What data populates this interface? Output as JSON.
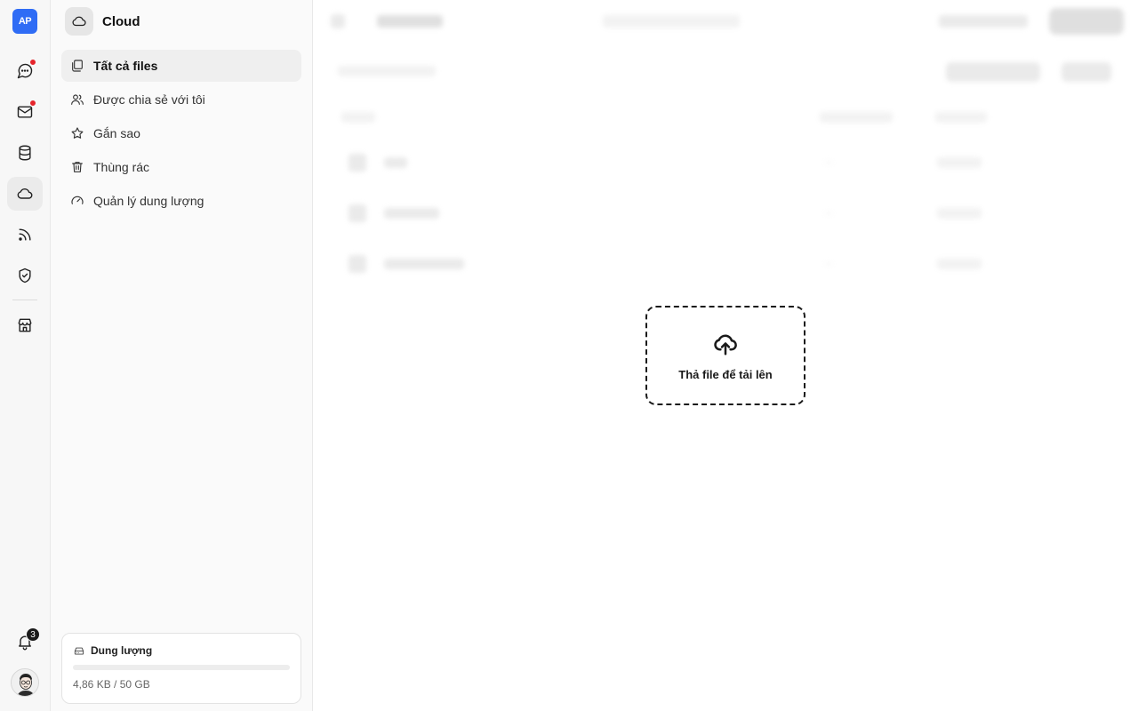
{
  "rail": {
    "logo_text": "AP",
    "items": [
      {
        "icon": "chat-icon",
        "has_dot": true
      },
      {
        "icon": "mail-icon",
        "has_dot": true
      },
      {
        "icon": "database-icon",
        "has_dot": false
      },
      {
        "icon": "cloud-icon",
        "has_dot": false,
        "active": true
      },
      {
        "icon": "rss-icon",
        "has_dot": false
      },
      {
        "icon": "shield-check-icon",
        "has_dot": false
      },
      {
        "icon": "store-icon",
        "has_dot": false
      }
    ],
    "notification_count": "3"
  },
  "sidebar": {
    "title": "Cloud",
    "nav": [
      {
        "label": "Tất cả files",
        "icon": "files-icon",
        "active": true
      },
      {
        "label": "Được chia sẻ với tôi",
        "icon": "users-icon"
      },
      {
        "label": "Gắn sao",
        "icon": "star-icon"
      },
      {
        "label": "Thùng rác",
        "icon": "trash-icon"
      },
      {
        "label": "Quản lý dung lượng",
        "icon": "gauge-icon"
      }
    ],
    "storage": {
      "title": "Dung lượng",
      "usage_text": "4,86 KB / 50 GB",
      "used_fraction": 1e-07
    }
  },
  "dropzone": {
    "label": "Thả file để tải lên",
    "icon": "cloud-upload-icon"
  },
  "colors": {
    "accent": "#2f6cf5",
    "notification_dot": "#e5242b"
  }
}
